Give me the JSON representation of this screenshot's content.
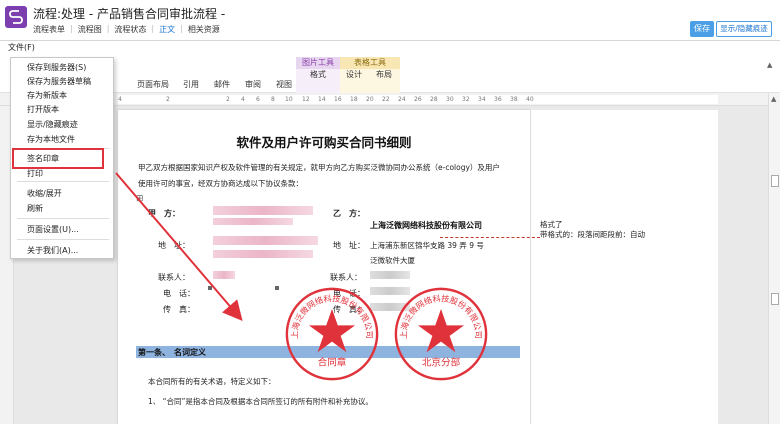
{
  "header": {
    "title": "流程:处理 - 产品销售合同审批流程 -",
    "nav": [
      {
        "label": "流程表单",
        "active": false
      },
      {
        "label": "流程图",
        "active": false
      },
      {
        "label": "流程状态",
        "active": false
      },
      {
        "label": "正文",
        "active": true
      },
      {
        "label": "相关资源",
        "active": false
      }
    ],
    "save_label": "保存",
    "toggle_label": "显示/隐藏痕迹"
  },
  "filebar": {
    "file_label": "文件(F)"
  },
  "ribbon": {
    "tabs": [
      "页面布局",
      "引用",
      "邮件",
      "审阅",
      "视图"
    ],
    "picture_tools": {
      "caption": "图片工具",
      "tab": "格式"
    },
    "table_tools": {
      "caption": "表格工具",
      "tabs": [
        "设计",
        "布局"
      ]
    }
  },
  "ruler": {
    "ticks": [
      "4",
      "2",
      "2",
      "4",
      "6",
      "8",
      "10",
      "12",
      "14",
      "16",
      "18",
      "20",
      "22",
      "24",
      "26",
      "28",
      "30",
      "32",
      "34",
      "36",
      "38",
      "40"
    ]
  },
  "menu": {
    "items": [
      "保存到服务器(S)",
      "保存为服务器草稿",
      "存为新版本",
      "打开版本",
      "显示/隐藏痕迹",
      "存为本地文件",
      "签名印章",
      "打印",
      "收缩/展开",
      "刷新",
      "页面设置(U)...",
      "关于我们(A)..."
    ]
  },
  "document": {
    "title": "软件及用户许可购买合同书细则",
    "intro_line1": "甲乙双方根据国家知识产权及软件管理的有关规定，就甲方向乙方购买泛微协同办公系统（e-cology）及用户",
    "intro_line2": "使用许可的事宜，经双方协商达成以下协议条款：",
    "party_a": "甲　方：",
    "party_b": "乙　方：",
    "company_b": "上海泛微网络科技股份有限公司",
    "address_label": "地　址：",
    "address_b_label": "地　址：",
    "address_b_line1": "上海浦东新区锦华支路 39 弄 9 号",
    "address_b_line2": "泛微软件大厦",
    "contact_a": "联系人：",
    "contact_b": "联系人：",
    "phone_a": "电　话：",
    "phone_b": "电　话：",
    "fax_a": "传　真：",
    "fax_b": "传　真：",
    "section_title": "第一条、　名词定义",
    "def_intro": "本合同所有的有关术语，特定义如下：",
    "def_item1": "1、 “合同”是指本合同及根据本合同所签订的所有附件和补充协议。"
  },
  "comment": {
    "line1": "格式了",
    "line2": "带格式的：段落间距段前：自动"
  },
  "seals": [
    {
      "text_ring": "上海泛微网络科技股份有限公司",
      "center_text": "合同章"
    },
    {
      "text_ring": "上海泛微网络科技股份有限公司",
      "center_text": "北京分部"
    }
  ],
  "colors": {
    "accent": "#4a9fe6",
    "seal": "#e0323a",
    "logo": "#7b3fb0"
  }
}
